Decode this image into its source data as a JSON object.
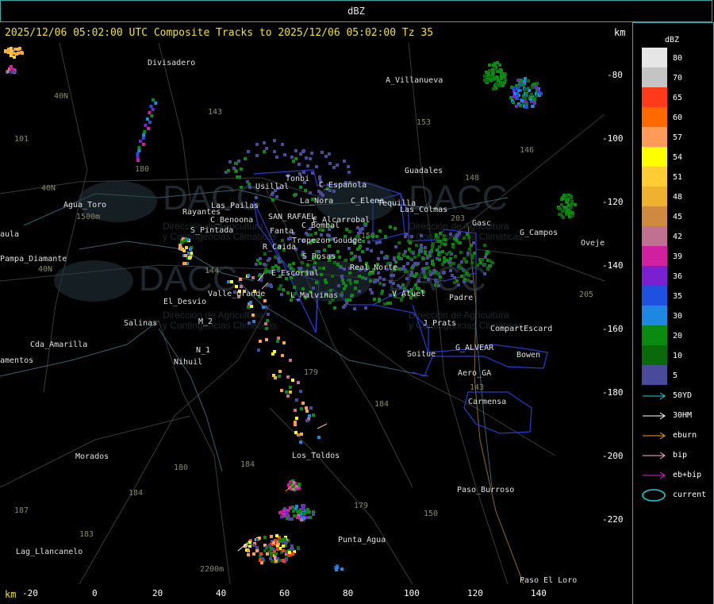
{
  "header": {
    "product": "dBZ"
  },
  "title": "2025/12/06 05:02:00 UTC Composite Tracks to 2025/12/06 05:02:00 Tz 35",
  "axis_unit": "km",
  "y_ticks": [
    "-80",
    "-100",
    "-120",
    "-140",
    "-160",
    "-180",
    "-200",
    "-220"
  ],
  "x_ticks": [
    "-20",
    "0",
    "20",
    "40",
    "60",
    "80",
    "100",
    "120",
    "140"
  ],
  "legend": {
    "title": "dBZ",
    "levels": [
      {
        "label": "80",
        "color": "#e6e6e6"
      },
      {
        "label": "70",
        "color": "#c4c4c4"
      },
      {
        "label": "65",
        "color": "#ff3a1a"
      },
      {
        "label": "60",
        "color": "#ff6a00"
      },
      {
        "label": "57",
        "color": "#ff9a5a"
      },
      {
        "label": "54",
        "color": "#ffff00"
      },
      {
        "label": "51",
        "color": "#ffcc33"
      },
      {
        "label": "48",
        "color": "#f0b030"
      },
      {
        "label": "45",
        "color": "#d08a40"
      },
      {
        "label": "42",
        "color": "#c07090"
      },
      {
        "label": "39",
        "color": "#d020a0"
      },
      {
        "label": "36",
        "color": "#7a20d0"
      },
      {
        "label": "35",
        "color": "#2050e0"
      },
      {
        "label": "30",
        "color": "#1e88e0"
      },
      {
        "label": "20",
        "color": "#0a8a10"
      },
      {
        "label": "10",
        "color": "#0a6a0a"
      },
      {
        "label": "5",
        "color": "#4a4a9a"
      }
    ],
    "tracks": [
      {
        "label": "50YD",
        "color": "#20d0e0"
      },
      {
        "label": "30HM",
        "color": "#ffffff"
      },
      {
        "label": "eburn",
        "color": "#f0a020"
      },
      {
        "label": "bip",
        "color": "#ffb0d0"
      },
      {
        "label": "eb+bip",
        "color": "#e020e0"
      },
      {
        "label": "current",
        "color": "#20d0e0"
      }
    ]
  },
  "places": [
    {
      "name": "Divisadero"
    },
    {
      "name": "A_Villanueva"
    },
    {
      "name": "Guadales"
    },
    {
      "name": "Usillal"
    },
    {
      "name": "Tonbi"
    },
    {
      "name": "C_Española"
    },
    {
      "name": "C_Elena"
    },
    {
      "name": "Tequilla"
    },
    {
      "name": "La_Nora"
    },
    {
      "name": "Agua_Toro"
    },
    {
      "name": "Rayantes"
    },
    {
      "name": "Las_Pailas"
    },
    {
      "name": "C_Benoona"
    },
    {
      "name": "SAN_RAFAEL"
    },
    {
      "name": "E_Alcarrobal"
    },
    {
      "name": "Las_Colmas"
    },
    {
      "name": "C_Bombal"
    },
    {
      "name": "S_Pintada"
    },
    {
      "name": "Pampa_Diamante"
    },
    {
      "name": "Fanta"
    },
    {
      "name": "Tropezon"
    },
    {
      "name": "Goudge"
    },
    {
      "name": "R_Caida"
    },
    {
      "name": "S_Rosas"
    },
    {
      "name": "Real_Norte"
    },
    {
      "name": "E_Escorial"
    },
    {
      "name": "Valle_Grande"
    },
    {
      "name": "L_Malvinas"
    },
    {
      "name": "V_Atuel"
    },
    {
      "name": "Padre"
    },
    {
      "name": "El_Desvio"
    },
    {
      "name": "Salinas"
    },
    {
      "name": "M_2"
    },
    {
      "name": "N_1"
    },
    {
      "name": "Nihuil"
    },
    {
      "name": "J_Prats"
    },
    {
      "name": "CompartEscard"
    },
    {
      "name": "G_ALVEAR"
    },
    {
      "name": "Soitue"
    },
    {
      "name": "Bowen"
    },
    {
      "name": "Aero_GA"
    },
    {
      "name": "Carmensa"
    },
    {
      "name": "Cda_Amarilla"
    },
    {
      "name": "amentos"
    },
    {
      "name": "Morados"
    },
    {
      "name": "Los_Toldos"
    },
    {
      "name": "Paso_Burroso"
    },
    {
      "name": "Punta_Agua"
    },
    {
      "name": "Lag_Llancanelo"
    },
    {
      "name": "Paso_El_Loro"
    },
    {
      "name": "G_Campos"
    },
    {
      "name": "Oveje"
    },
    {
      "name": "Gasc"
    },
    {
      "name": "aula"
    },
    {
      "name": "1500m"
    },
    {
      "name": "2200m"
    }
  ],
  "grid_labels": [
    "143",
    "153",
    "146",
    "148",
    "203",
    "101",
    "40N",
    "40N",
    "40N",
    "180",
    "184",
    "184",
    "179",
    "183",
    "150",
    "143",
    "144",
    "180",
    "187",
    "184",
    "205",
    "150",
    "179"
  ],
  "watermark": {
    "brand": "DACC",
    "line1": "Dirección de Agricultura",
    "line2": "y Contingencias Climáticas"
  }
}
